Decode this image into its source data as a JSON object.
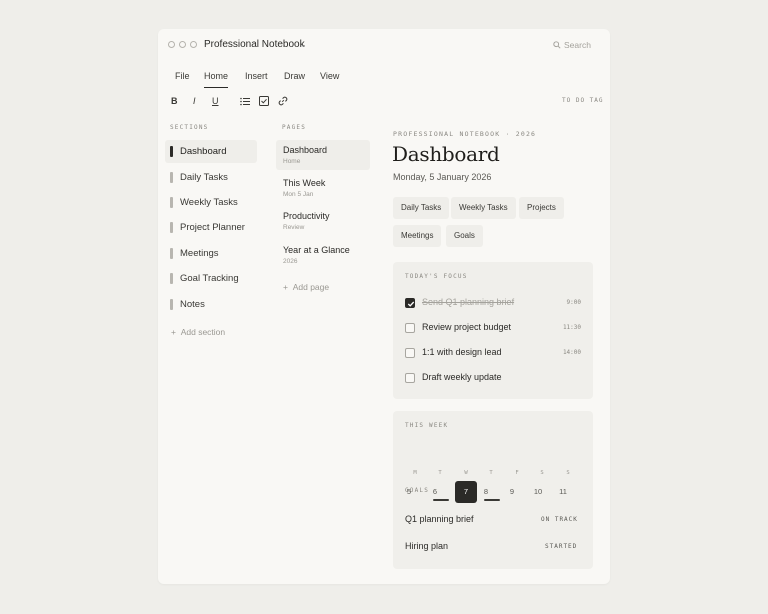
{
  "window": {
    "title": "Professional Notebook",
    "search_placeholder": "Search"
  },
  "menu": [
    "File",
    "Home",
    "Insert",
    "Draw",
    "View"
  ],
  "active_menu": "Home",
  "toolbar": {
    "bold": "B",
    "italic": "I",
    "underline": "U",
    "todo_tag": "TO DO TAG"
  },
  "sections": {
    "header": "SECTIONS",
    "items": [
      "Dashboard",
      "Daily Tasks",
      "Weekly Tasks",
      "Project Planner",
      "Meetings",
      "Goal Tracking",
      "Notes"
    ],
    "active": "Dashboard",
    "add_label": "Add section"
  },
  "pages": {
    "header": "PAGES",
    "items": [
      {
        "title": "Dashboard",
        "subtitle": "Home"
      },
      {
        "title": "This Week",
        "subtitle": "Mon 5 Jan"
      },
      {
        "title": "Productivity",
        "subtitle": "Review"
      },
      {
        "title": "Year at a Glance",
        "subtitle": "2026"
      }
    ],
    "add_label": "Add page"
  },
  "main": {
    "kicker": "PROFESSIONAL NOTEBOOK · 2026",
    "title": "Dashboard",
    "date": "Monday, 5 January 2026",
    "chips": [
      "Daily Tasks",
      "Weekly Tasks",
      "Projects",
      "Meetings",
      "Goals"
    ]
  },
  "focus": {
    "header": "TODAY'S FOCUS",
    "tasks": [
      {
        "label": "Send Q1 planning brief",
        "time": "9:00",
        "done": true
      },
      {
        "label": "Review project budget",
        "time": "11:30",
        "done": false
      },
      {
        "label": "1:1 with design lead",
        "time": "14:00",
        "done": false
      },
      {
        "label": "Draft weekly update",
        "time": "",
        "done": false
      }
    ]
  },
  "week": {
    "header": "THIS WEEK",
    "weekdays": [
      "M",
      "T",
      "W",
      "T",
      "F",
      "S",
      "S"
    ],
    "days": [
      "5",
      "6",
      "7",
      "8",
      "9",
      "10",
      "11"
    ],
    "today": "7",
    "goals_header": "GOALS",
    "goals": [
      {
        "label": "Q1 planning brief",
        "status": "ON TRACK"
      },
      {
        "label": "Hiring plan",
        "status": "STARTED"
      }
    ]
  },
  "colors": {
    "accent": "#2b2a27",
    "background": "#efeeea",
    "panel": "#f9f8f5"
  },
  "icons": [
    "bold-icon",
    "italic-icon",
    "underline-icon",
    "bullet-list-icon",
    "checkbox-icon",
    "link-icon",
    "search-icon",
    "plus-icon",
    "chevron-down-icon"
  ]
}
